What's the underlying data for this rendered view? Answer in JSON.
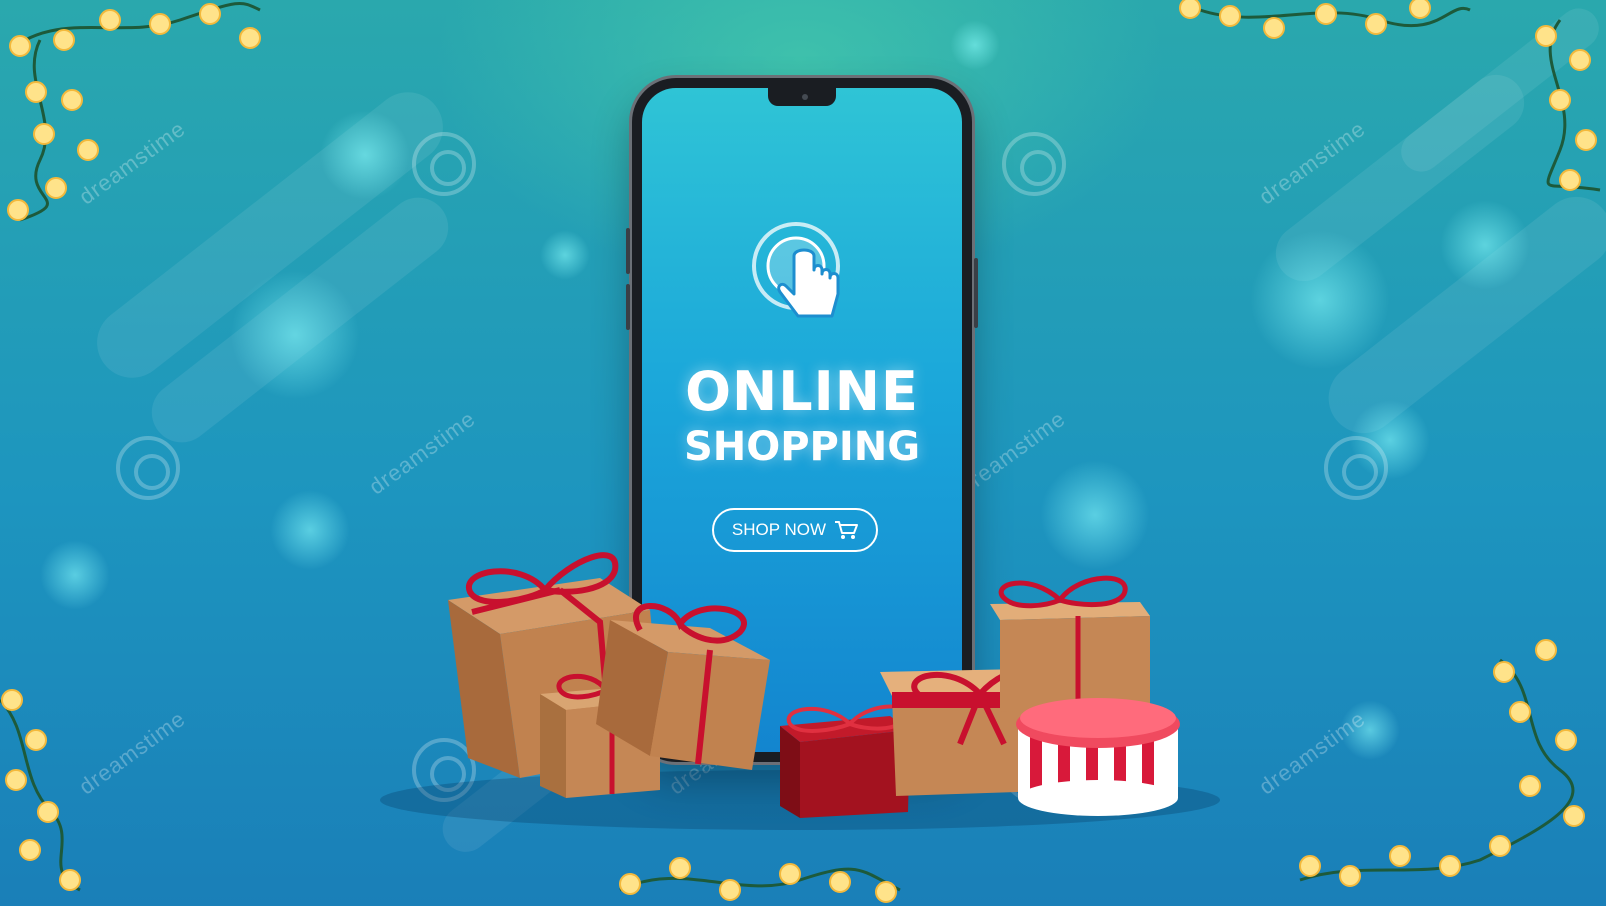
{
  "banner": {
    "title_line1": "ONLINE",
    "title_line2": "SHOPPING",
    "cta_label": "SHOP NOW",
    "cta_icon": "shopping-cart-icon",
    "tap_icon": "pointer-hand-icon"
  },
  "watermark": {
    "text": "dreamstime",
    "logo_icon": "swirl-logo-icon"
  },
  "colors": {
    "background": "#1d95bf",
    "screen": "#1ba7da",
    "gift_brown": "#b77a4a",
    "ribbon": "#c8102e",
    "bulb": "#ffe38a"
  }
}
